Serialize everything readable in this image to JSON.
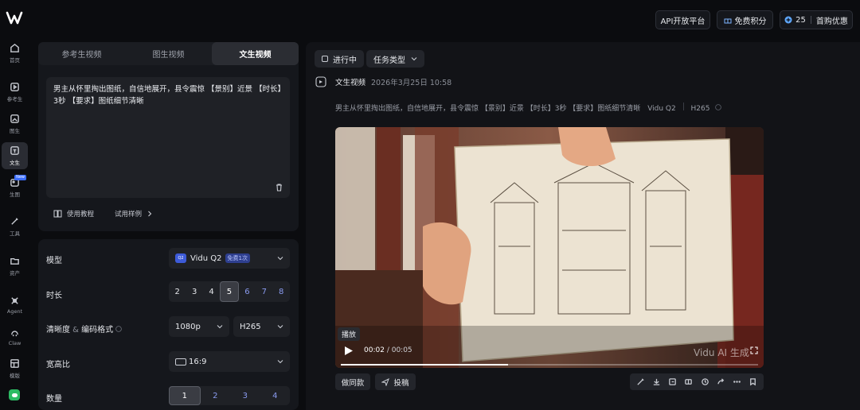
{
  "topbar": {
    "api_label": "API开放平台",
    "free_credits_label": "免费积分",
    "credits_value": "25",
    "first_purchase_label": "首购优惠"
  },
  "rail": {
    "items": [
      {
        "label": "首页",
        "icon": "home-icon"
      },
      {
        "label": "参考生",
        "icon": "reference-icon"
      },
      {
        "label": "图生",
        "icon": "image-to-video-icon"
      },
      {
        "label": "文生",
        "icon": "text-to-video-icon",
        "active": true
      },
      {
        "label": "生图",
        "icon": "image-generate-icon",
        "badge": "New"
      },
      {
        "label": "工具",
        "icon": "tools-icon"
      },
      {
        "label": "资产",
        "icon": "folder-icon"
      },
      {
        "label": "Agent",
        "icon": "agent-icon"
      },
      {
        "label": "Claw",
        "icon": "claw-icon"
      },
      {
        "label": "模版",
        "icon": "template-icon"
      }
    ]
  },
  "tabs": [
    "参考生视频",
    "图生视频",
    "文生视频"
  ],
  "active_tab": 2,
  "prompt": {
    "text": "男主从怀里掏出图纸，自信地展开，县令震惊 【景别】近景 【时长】3秒 【要求】图纸细节清晰",
    "tutorial_label": "使用教程",
    "sample_label": "试用样例"
  },
  "form": {
    "model_label": "模型",
    "model_value": "Vidu Q2",
    "model_badge": "免费1次",
    "duration_label": "时长",
    "duration_options": [
      "2",
      "3",
      "4",
      "5",
      "6",
      "7",
      "8"
    ],
    "duration_selected": "5",
    "resolution_label": "清晰度",
    "codec_label": "编码格式",
    "resolution_value": "1080p",
    "codec_value": "H265",
    "aspect_label": "宽高比",
    "aspect_value": "16:9",
    "count_label": "数量",
    "count_options": [
      "1",
      "2",
      "3",
      "4"
    ],
    "count_selected": "1"
  },
  "filters": {
    "status_label": "进行中",
    "task_type_label": "任务类型"
  },
  "task": {
    "type_label": "文生视频",
    "timestamp": "2026年3月25日 10:58",
    "description": "男主从怀里掏出图纸，自信地展开，县令震惊 【景别】近景 【时长】3秒 【要求】图纸细节清晰",
    "model": "Vidu Q2",
    "codec": "H265"
  },
  "video": {
    "play_tooltip": "播放",
    "current_time": "00:02",
    "duration": "00:05",
    "watermark": "Vidu AI 生成",
    "progress": 0.4
  },
  "actions": {
    "make_same_label": "做同款",
    "submit_label": "投稿"
  },
  "colors": {
    "background": "#0b0c0f",
    "panel": "#15171c",
    "accent": "#3b6dff",
    "credit_blue": "#5fa8ff"
  }
}
